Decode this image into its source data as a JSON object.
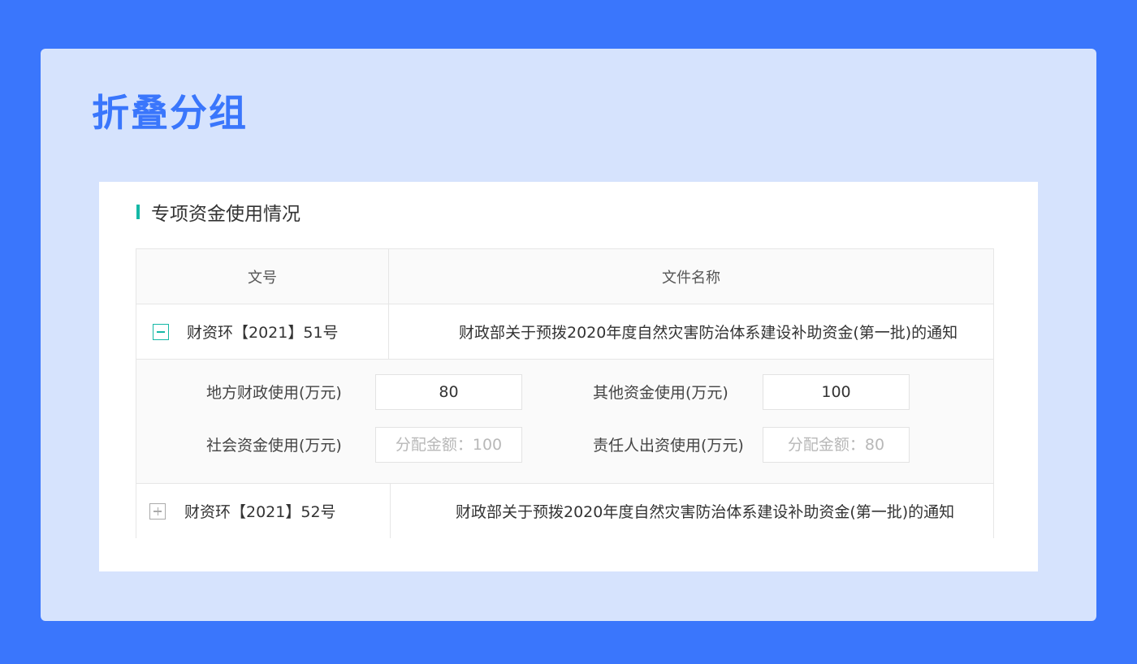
{
  "page": {
    "title": "折叠分组"
  },
  "section": {
    "title": "专项资金使用情况"
  },
  "table": {
    "headers": [
      "文号",
      "文件名称"
    ],
    "rows": [
      {
        "doc_no": "财资环【2021】51号",
        "doc_name": "财政部关于预拨2020年度自然灾害防治体系建设补助资金(第一批)的通知",
        "expanded": true
      },
      {
        "doc_no": "财资环【2021】52号",
        "doc_name": "财政部关于预拨2020年度自然灾害防治体系建设补助资金(第一批)的通知",
        "expanded": false
      }
    ],
    "detail": {
      "local_finance": {
        "label": "地方财政使用(万元)",
        "value": "80",
        "placeholder": ""
      },
      "other_funds": {
        "label": "其他资金使用(万元)",
        "value": "100",
        "placeholder": ""
      },
      "social_funds": {
        "label": "社会资金使用(万元)",
        "value": "",
        "placeholder": "分配金额：100"
      },
      "responsible_funds": {
        "label": "责任人出资使用(万元)",
        "value": "",
        "placeholder": "分配金额：80"
      }
    }
  },
  "colors": {
    "background": "#3a76fc",
    "card": "#d6e3fd",
    "accent": "#14b8a6",
    "title": "#3a76fc"
  },
  "icons": {
    "collapse": "minus-square-icon",
    "expand": "plus-square-icon"
  }
}
